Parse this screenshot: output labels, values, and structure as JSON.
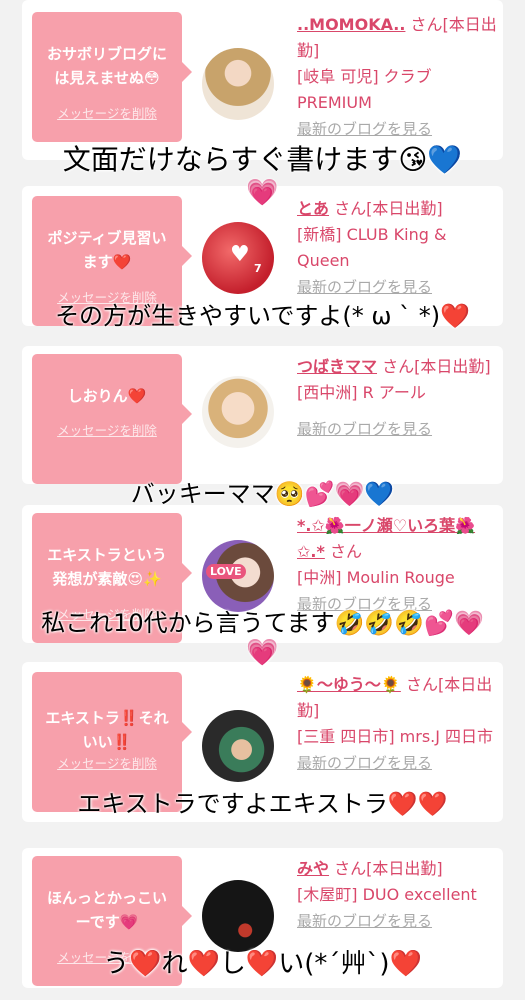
{
  "cards": [
    {
      "bubble": "おサボリブログには見えませぬ😳",
      "delete": "メッセージを削除",
      "name": "..MOMOKA..",
      "honorific": "さん[本日出勤]",
      "store": "[岐阜 可児] クラブPREMIUM",
      "blog": "最新のブログを見る"
    },
    {
      "bubble": "ポジティブ見習います❤️",
      "delete": "メッセージを削除",
      "name": "とあ",
      "honorific": "さん[本日出勤]",
      "store": "[新橋] CLUB King & Queen",
      "blog": "最新のブログを見る"
    },
    {
      "bubble": "しおりん❤️",
      "delete": "メッセージを削除",
      "name": "つばきママ",
      "honorific": "さん[本日出勤]",
      "store": "[西中洲] R アール",
      "blog": "最新のブログを見る"
    },
    {
      "bubble": "エキストラという発想が素敵😍✨",
      "delete": "メッセージを削除",
      "name": "*.✩🌺一ノ瀬♡いろ葉🌺✩.*",
      "honorific": "さん",
      "store": "[中洲] Moulin Rouge",
      "blog": "最新のブログを見る"
    },
    {
      "bubble": "エキストラ‼️それいい‼️",
      "delete": "メッセージを削除",
      "name": "🌻〜ゆう〜🌻",
      "honorific": "さん[本日出勤]",
      "store": "[三重 四日市] mrs.J 四日市",
      "blog": "最新のブログを見る"
    },
    {
      "bubble": "ほんっとかっこいーです💗",
      "delete": "メッセージを削除",
      "name": "みや",
      "honorific": "さん[本日出勤]",
      "store": "[木屋町] DUO excellent",
      "blog": "最新のブログを見る"
    }
  ],
  "overlays": {
    "c1": "文面だけならすぐ書けます😘💙",
    "c1b": "💗",
    "c2": "その方が生きやすいですよ(* ω ` *)❤️",
    "c3": "バッキーママ🥺💕💗💙",
    "c4": "私これ10代から言うてます🤣🤣🤣💕💗",
    "c4b": "💗",
    "c5": "エキストラですよエキストラ❤️❤️",
    "c6": "う❤️れ❤️し❤️い(*´艸`)❤️"
  },
  "avatar_labels": {
    "toa": "7",
    "iroha": "LOVE"
  },
  "colors": {
    "accent": "#d9476a",
    "bubble": "#f7a0ab",
    "background": "#f2f2f2"
  }
}
